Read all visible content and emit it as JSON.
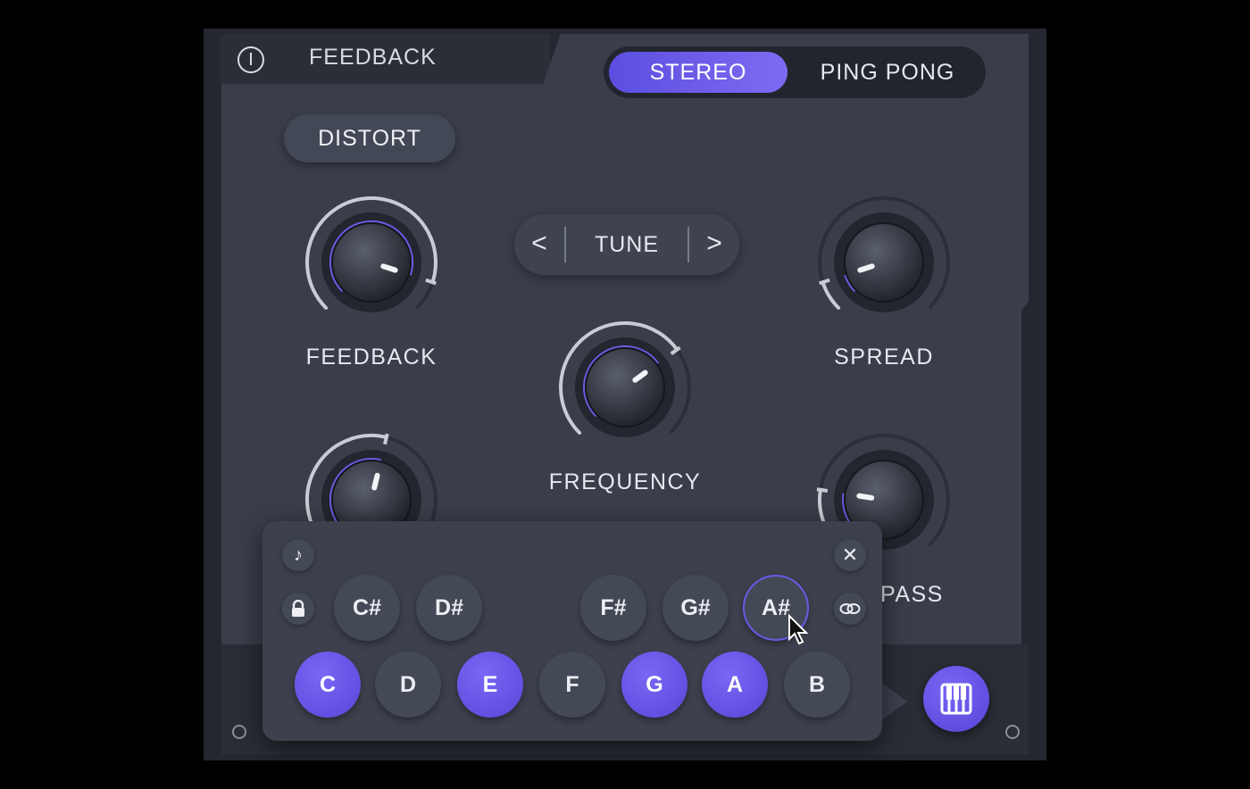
{
  "header": {
    "tab_title": "FEEDBACK",
    "power_icon": "power-icon"
  },
  "mode": {
    "options": [
      "STEREO",
      "PING PONG"
    ],
    "selected": "STEREO"
  },
  "distort": {
    "label": "DISTORT"
  },
  "tune": {
    "label": "TUNE",
    "prev": "<",
    "next": ">"
  },
  "knobs": {
    "feedback": {
      "label": "FEEDBACK",
      "value_fraction": 0.9
    },
    "spread": {
      "label": "SPREAD",
      "value_fraction": 0.1
    },
    "frequency": {
      "label": "FREQUENCY",
      "value_fraction": 0.7
    },
    "left_lower": {
      "label": "",
      "value_fraction": 0.55
    },
    "right_lower": {
      "label": "PASS",
      "value_fraction": 0.2
    }
  },
  "popup": {
    "sharps": [
      "C#",
      "D#",
      "F#",
      "G#",
      "A#"
    ],
    "naturals": [
      "C",
      "D",
      "E",
      "F",
      "G",
      "A",
      "B"
    ],
    "active_notes": [
      "C",
      "E",
      "G",
      "A"
    ],
    "hover_note": "A#",
    "close_label": "✕",
    "note_icon": "♪",
    "lock_icon": "lock-icon",
    "link_icon": "link-icon"
  },
  "colors": {
    "accent": "#6c5ce7",
    "panel": "#3a3e4a",
    "background": "#000000"
  }
}
